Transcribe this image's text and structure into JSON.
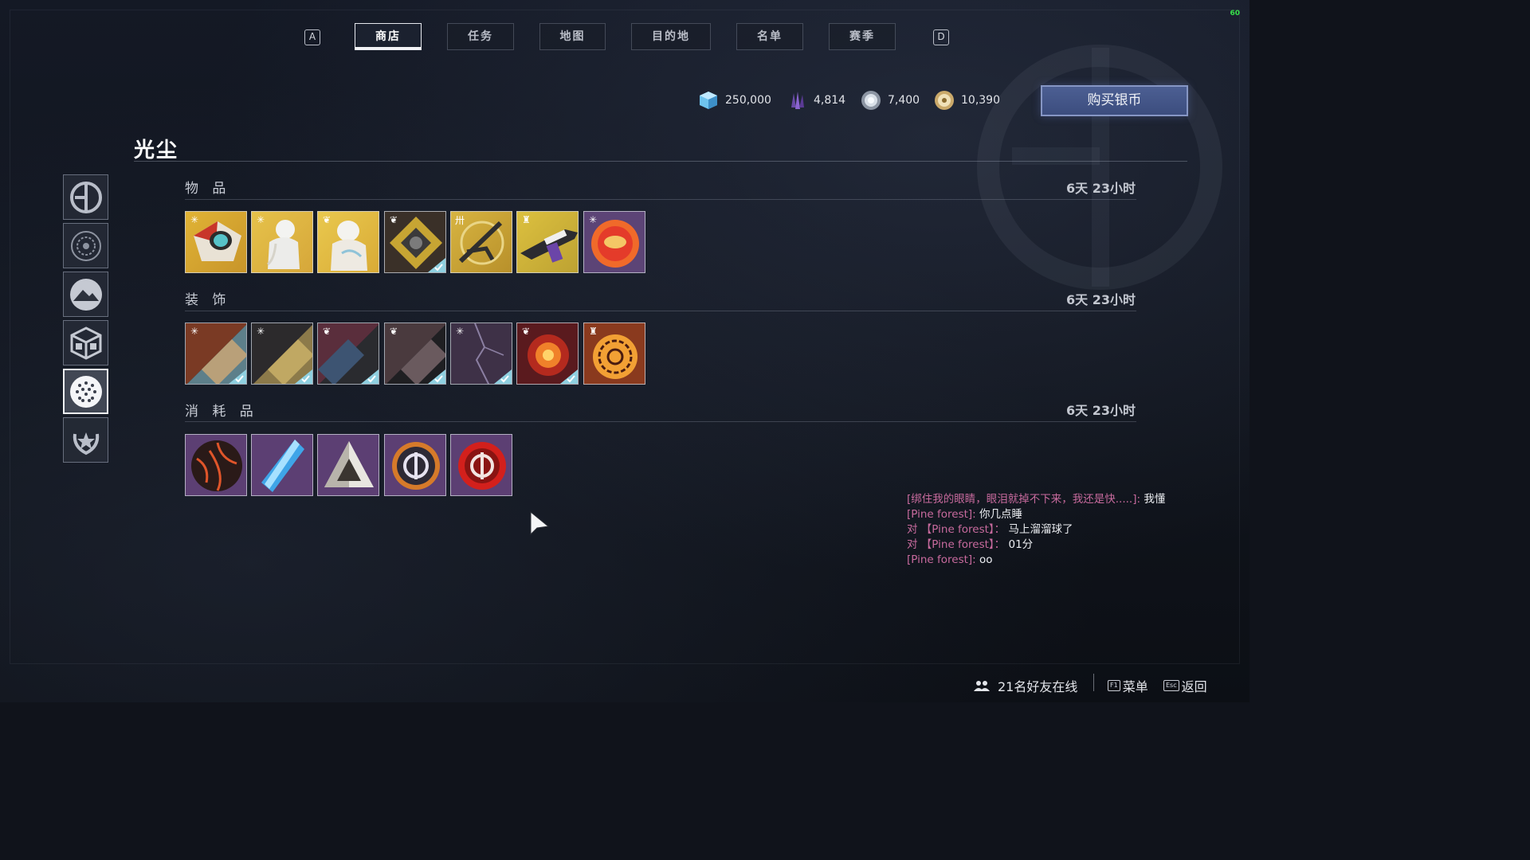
{
  "fps": "60",
  "nav": {
    "left_key": "A",
    "right_key": "D",
    "tabs": [
      "商店",
      "任务",
      "地图",
      "目的地",
      "名单",
      "赛季"
    ],
    "active_tab": "商店"
  },
  "currencies": [
    {
      "icon": "glimmer-cube-icon",
      "value": "250,000"
    },
    {
      "icon": "legendary-shards-icon",
      "value": "4,814"
    },
    {
      "icon": "bright-dust-icon",
      "value": "7,400"
    },
    {
      "icon": "silver-coin-icon",
      "value": "10,390"
    }
  ],
  "buy_button": "购买银币",
  "page_title": "光尘",
  "vendors": [
    "eververse-icon",
    "crucible-emblem-icon",
    "gambit-icon",
    "cube-icon",
    "bright-dust-vendor-icon",
    "laurel-star-icon"
  ],
  "active_vendor": 4,
  "sections": [
    {
      "label": "物 品",
      "timer": "6天 23小时",
      "items": [
        {
          "name": "ghost-shell-item",
          "owned": false
        },
        {
          "name": "armor-ornament-item",
          "owned": false
        },
        {
          "name": "armor-ornament-2-item",
          "owned": false
        },
        {
          "name": "ship-item",
          "owned": true
        },
        {
          "name": "weapon-ornament-item",
          "owned": false
        },
        {
          "name": "sniper-ornament-item",
          "owned": false
        },
        {
          "name": "emote-item",
          "owned": false
        }
      ]
    },
    {
      "label": "装 饰",
      "timer": "6天 23小时",
      "items": [
        {
          "name": "shader-1-item",
          "owned": true
        },
        {
          "name": "shader-2-item",
          "owned": true
        },
        {
          "name": "shader-3-item",
          "owned": true
        },
        {
          "name": "shader-4-item",
          "owned": true
        },
        {
          "name": "shader-5-item",
          "owned": true
        },
        {
          "name": "transmat-item",
          "owned": true
        },
        {
          "name": "projection-item",
          "owned": false
        }
      ]
    },
    {
      "label": "消 耗 品",
      "timer": "6天 23小时",
      "items": [
        {
          "name": "ornate-sphere-item",
          "owned": false
        },
        {
          "name": "blue-crystal-item",
          "owned": false
        },
        {
          "name": "prism-item",
          "owned": false
        },
        {
          "name": "eververse-token-item",
          "owned": false
        },
        {
          "name": "red-engram-item",
          "owned": false
        }
      ]
    }
  ],
  "chat": [
    {
      "prefix": "[绑住我的眼睛，眼泪就掉不下来，我还是快.....]: ",
      "message": "我懂"
    },
    {
      "prefix": "[Pine forest]: ",
      "message": "你几点睡"
    },
    {
      "prefix": "对 【Pine forest】： ",
      "message": "马上溜溜球了"
    },
    {
      "prefix": "对 【Pine forest】： ",
      "message": "01分"
    },
    {
      "prefix": "[Pine forest]: ",
      "message": "oo"
    }
  ],
  "bottom": {
    "friends": "21名好友在线",
    "menu_key": "F1",
    "menu_label": "菜单",
    "back_key": "Esc",
    "back_label": "返回"
  },
  "colors": {
    "accent_button": "#4c5f93",
    "chat_name": "#c76a9d",
    "check": "#8fd0e0"
  }
}
